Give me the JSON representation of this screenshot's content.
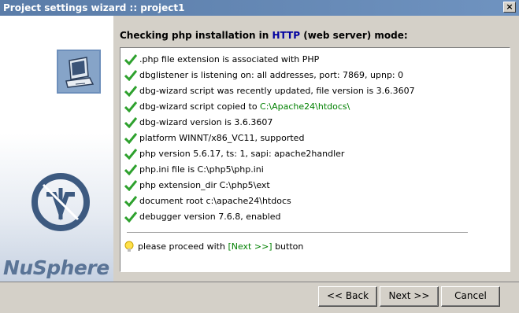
{
  "window": {
    "title": "Project settings wizard :: project1",
    "close_label": "×"
  },
  "branding": {
    "logo_text": "NuSphere"
  },
  "header": {
    "prefix": "Checking php installation in",
    "protocol": "HTTP",
    "suffix": "(web server) mode:"
  },
  "checks": [
    {
      "text": ".php file extension is associated with PHP"
    },
    {
      "text": "dbglistener is listening on: all addresses, port: 7869, upnp: 0"
    },
    {
      "text": "dbg-wizard script was recently updated, file version is 3.6.3607"
    },
    {
      "text": "dbg-wizard script copied to ",
      "path": "C:\\Apache24\\htdocs\\"
    },
    {
      "text": "dbg-wizard version is 3.6.3607"
    },
    {
      "text": "platform WINNT/x86_VC11, supported"
    },
    {
      "text": "php version 5.6.17, ts: 1, sapi: apache2handler"
    },
    {
      "text": "php.ini file is C:\\php5\\php.ini"
    },
    {
      "text": "php extension_dir C:\\php5\\ext"
    },
    {
      "text": "document root c:\\apache24\\htdocs"
    },
    {
      "text": "debugger version 7.6.8, enabled"
    }
  ],
  "hint": {
    "prefix": "please proceed with ",
    "button_ref": "[Next >>]",
    "suffix": " button"
  },
  "buttons": {
    "back": "<< Back",
    "next": "Next >>",
    "cancel": "Cancel"
  },
  "colors": {
    "titlebar": "#5a7ca8",
    "check": "#2ea12e",
    "path": "#008000",
    "protocol": "#0000a0",
    "brand": "#5a7496"
  }
}
